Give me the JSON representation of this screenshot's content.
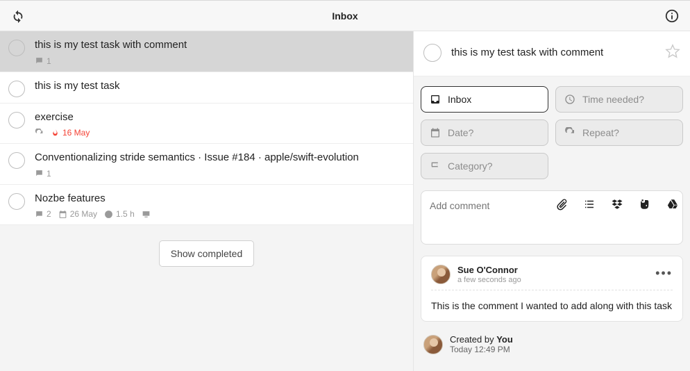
{
  "header": {
    "title": "Inbox"
  },
  "tasks": [
    {
      "title": "this is my test task with comment",
      "selected": true,
      "meta": {
        "comments": "1"
      }
    },
    {
      "title": "this is my test task",
      "selected": false,
      "meta": {}
    },
    {
      "title": "exercise",
      "selected": false,
      "meta": {
        "recurring": true,
        "due": "16 May",
        "due_danger": true
      }
    },
    {
      "title": "Conventionalizing stride semantics · Issue #184 · apple/swift-evolution",
      "selected": false,
      "meta": {
        "comments": "1"
      }
    },
    {
      "title": "Nozbe features",
      "selected": false,
      "meta": {
        "comments": "2",
        "time": "1.5 h",
        "due": "26 May",
        "screen": true
      }
    }
  ],
  "showCompleted": "Show completed",
  "detail": {
    "title": "this is my test task with comment",
    "chips": {
      "inbox": "Inbox",
      "time": "Time needed?",
      "date": "Date?",
      "repeat": "Repeat?",
      "category": "Category?"
    },
    "commentPlaceholder": "Add comment",
    "comment": {
      "author": "Sue O'Connor",
      "time": "a few seconds ago",
      "body": "This is the comment I wanted to add along with this task"
    },
    "createdBy": {
      "prefix": "Created by ",
      "who": "You",
      "when": "Today 12:49 PM"
    }
  }
}
